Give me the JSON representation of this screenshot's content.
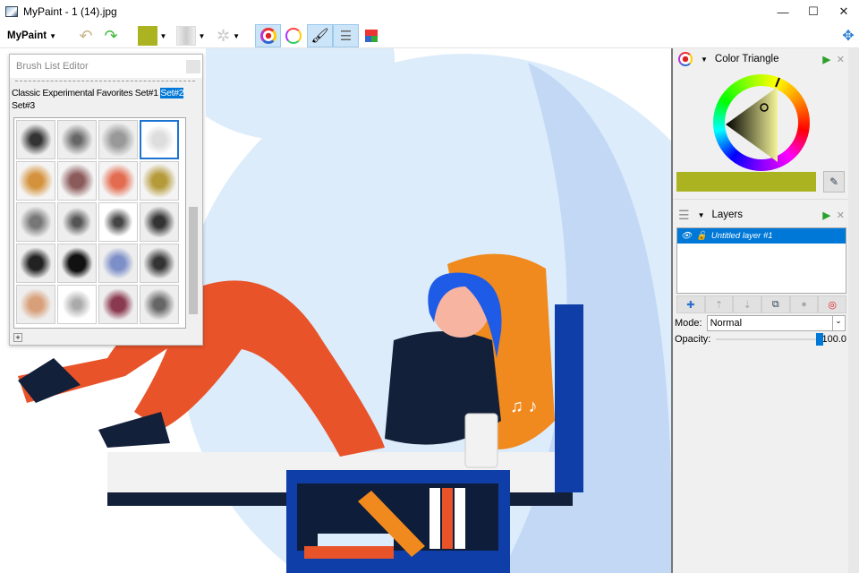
{
  "window": {
    "title": "MyPaint - 1 (14).jpg",
    "minimize": "—",
    "maximize": "☐",
    "close": "✕"
  },
  "toolbar": {
    "menu_label": "MyPaint",
    "color_swatch": "#acb321"
  },
  "brush_editor": {
    "title": "Brush List Editor",
    "groups": [
      "Classic",
      "Experimental",
      "Favorites",
      "Set#1",
      "Set#2",
      "Set#3"
    ],
    "selected_group": "Set#2",
    "add_label": "+"
  },
  "color_panel": {
    "title": "Color Triangle",
    "current_color": "#acb321"
  },
  "layers_panel": {
    "title": "Layers",
    "layers": [
      {
        "name": "Untitled layer #1",
        "visible": true,
        "locked": false
      }
    ],
    "mode_label": "Mode:",
    "mode_value": "Normal",
    "opacity_label": "Opacity:",
    "opacity_value": "100.0",
    "opacity_fraction": 1.0
  }
}
